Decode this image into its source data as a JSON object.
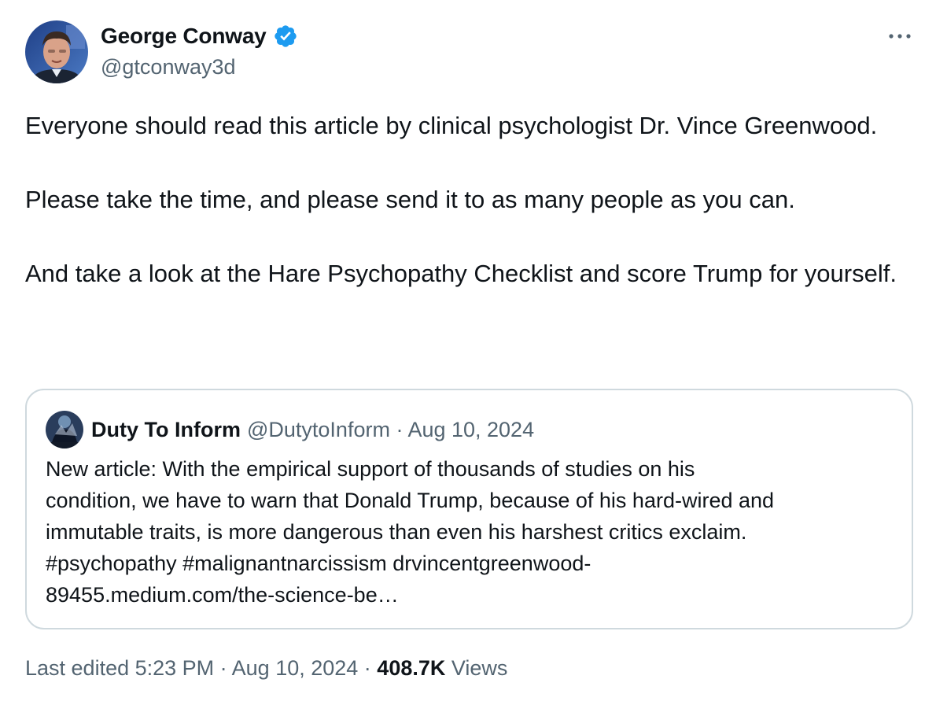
{
  "tweet": {
    "author": {
      "name": "George Conway",
      "handle": "@gtconway3d",
      "verified": true
    },
    "text_paragraphs": [
      "Everyone should read this article by clinical psychologist Dr. Vince Greenwood.",
      "Please take the time, and please send it to as many people as you can.",
      "And take a look at the Hare Psychopathy Checklist and score Trump for yourself."
    ],
    "edited_label": "Last edited 5:23 PM · Aug 10, 2024 · ",
    "views_count": "408.7K",
    "views_label": " Views"
  },
  "quoted_tweet": {
    "name": "Duty To Inform",
    "meta": "@DutytoInform · Aug 10, 2024",
    "text": "New article: With the empirical support of thousands of studies on his\ncondition, we have to warn that Donald Trump, because of his hard-wired and\nimmutable traits, is more dangerous than even his harshest critics exclaim.\n#psychopathy #malignantnarcissism drvincentgreenwood-\n89455.medium.com/the-science-be…"
  },
  "colors": {
    "primary_text": "#0f1419",
    "secondary_text": "#536471",
    "verified_badge": "#1d9bf0",
    "border": "#cfd9de"
  },
  "icons": {
    "verified": "verified-badge-icon",
    "more": "more-dots-icon"
  }
}
